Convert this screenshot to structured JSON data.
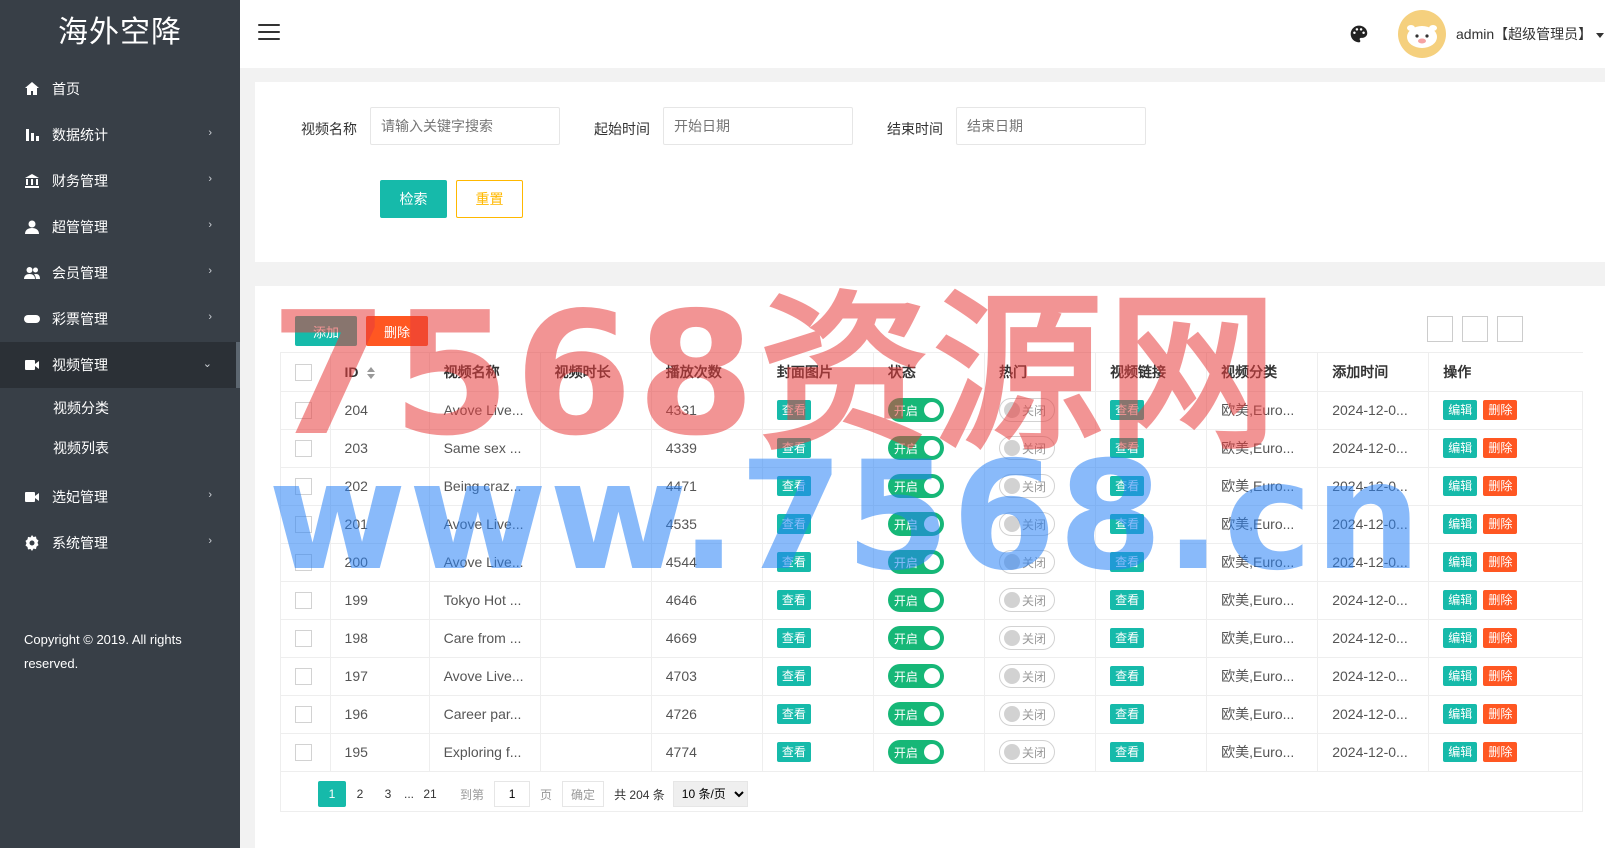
{
  "sidebar": {
    "logo": "海外空降",
    "items": [
      {
        "label": "首页",
        "icon": "home-icon",
        "has_arrow": false
      },
      {
        "label": "数据统计",
        "icon": "bar-chart-icon",
        "has_arrow": true
      },
      {
        "label": "财务管理",
        "icon": "bank-icon",
        "has_arrow": true
      },
      {
        "label": "超管管理",
        "icon": "user-icon",
        "has_arrow": true
      },
      {
        "label": "会员管理",
        "icon": "users-icon",
        "has_arrow": true
      },
      {
        "label": "彩票管理",
        "icon": "gamepad-icon",
        "has_arrow": true
      },
      {
        "label": "视频管理",
        "icon": "video-icon",
        "has_arrow": true,
        "expanded": true
      },
      {
        "label": "选妃管理",
        "icon": "video-icon",
        "has_arrow": true
      },
      {
        "label": "系统管理",
        "icon": "gear-icon",
        "has_arrow": true
      }
    ],
    "subitems": [
      "视频分类",
      "视频列表"
    ],
    "copyright": "Copyright © 2019. All rights reserved."
  },
  "header": {
    "user": "admin【超级管理员】"
  },
  "filter": {
    "name_label": "视频名称",
    "name_placeholder": "请输入关键字搜索",
    "start_label": "起始时间",
    "start_placeholder": "开始日期",
    "end_label": "结束时间",
    "end_placeholder": "结束日期",
    "search_btn": "检索",
    "reset_btn": "重置"
  },
  "toolbar": {
    "add": "添加",
    "delete": "删除"
  },
  "table": {
    "headers": [
      "ID",
      "视频名称",
      "视频时长",
      "播放次数",
      "封面图片",
      "状态",
      "热门",
      "视频链接",
      "视频分类",
      "添加时间",
      "操作"
    ],
    "view_label": "查看",
    "on_label": "开启",
    "off_label": "关闭",
    "edit_label": "编辑",
    "del_label": "删除",
    "rows": [
      {
        "id": "204",
        "name": "Avove Live...",
        "duration": "",
        "plays": "4331",
        "category": "欧美,Euro...",
        "time": "2024-12-0..."
      },
      {
        "id": "203",
        "name": "Same sex ...",
        "duration": "",
        "plays": "4339",
        "category": "欧美,Euro...",
        "time": "2024-12-0..."
      },
      {
        "id": "202",
        "name": "Being craz...",
        "duration": "",
        "plays": "4471",
        "category": "欧美,Euro...",
        "time": "2024-12-0..."
      },
      {
        "id": "201",
        "name": "Avove Live...",
        "duration": "",
        "plays": "4535",
        "category": "欧美,Euro...",
        "time": "2024-12-0..."
      },
      {
        "id": "200",
        "name": "Avove Live...",
        "duration": "",
        "plays": "4544",
        "category": "欧美,Euro...",
        "time": "2024-12-0..."
      },
      {
        "id": "199",
        "name": "Tokyo Hot ...",
        "duration": "",
        "plays": "4646",
        "category": "欧美,Euro...",
        "time": "2024-12-0..."
      },
      {
        "id": "198",
        "name": "Care from ...",
        "duration": "",
        "plays": "4669",
        "category": "欧美,Euro...",
        "time": "2024-12-0..."
      },
      {
        "id": "197",
        "name": "Avove Live...",
        "duration": "",
        "plays": "4703",
        "category": "欧美,Euro...",
        "time": "2024-12-0..."
      },
      {
        "id": "196",
        "name": "Career par...",
        "duration": "",
        "plays": "4726",
        "category": "欧美,Euro...",
        "time": "2024-12-0..."
      },
      {
        "id": "195",
        "name": "Exploring f...",
        "duration": "",
        "plays": "4774",
        "category": "欧美,Euro...",
        "time": "2024-12-0..."
      }
    ]
  },
  "pagination": {
    "current": "1",
    "pages": [
      "2",
      "3"
    ],
    "ellipsis": "...",
    "last": "21",
    "goto_label": "到第",
    "goto_value": "1",
    "page_unit": "页",
    "confirm": "确定",
    "total": "共 204 条",
    "per_page": "10 条/页"
  },
  "watermark": {
    "line1": "7568资源网",
    "line2": "www.7568.cn"
  },
  "colors": {
    "sidebar_bg": "#383f47",
    "accent": "#16baaa",
    "danger": "#ff5722",
    "warning": "#ffb800",
    "switch_on": "#16b777"
  }
}
